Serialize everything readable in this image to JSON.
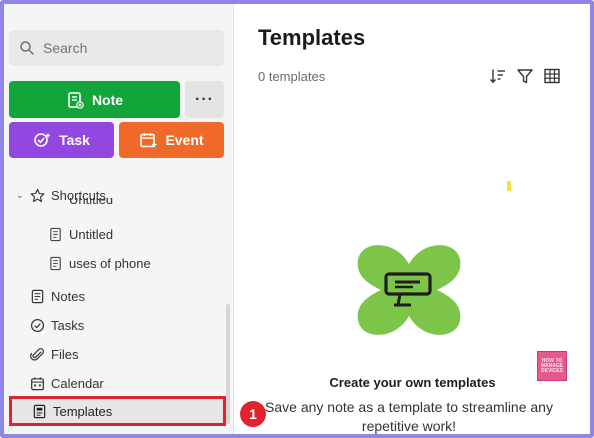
{
  "sidebar": {
    "search": {
      "label": "Search",
      "icon": "search-icon"
    },
    "new_note_label": "Note",
    "more_label": "···",
    "new_task_label": "Task",
    "new_event_label": "Event",
    "shortcuts": {
      "label": "Shortcuts",
      "items": [
        {
          "label": "Untitled",
          "clipped": true
        },
        {
          "label": "Untitled"
        },
        {
          "label": "uses of phone"
        }
      ]
    },
    "nav": [
      {
        "label": "Notes",
        "icon": "notes-icon"
      },
      {
        "label": "Tasks",
        "icon": "tasks-icon"
      },
      {
        "label": "Files",
        "icon": "paperclip-icon"
      },
      {
        "label": "Calendar",
        "icon": "calendar-icon"
      },
      {
        "label": "Templates",
        "icon": "template-icon",
        "selected": true
      }
    ]
  },
  "main": {
    "title": "Templates",
    "count": "0 templates",
    "tools": [
      "sort-icon",
      "filter-icon",
      "view-options-icon"
    ],
    "empty_state": {
      "title": "Create your own templates",
      "description": "Save any note as a template to streamline any repetitive work!"
    }
  },
  "annotation": {
    "step": "1",
    "color": "#e0242f"
  },
  "watermark_text": "HOW TO MANAGE DEVICES",
  "colors": {
    "note_button": "#12a63a",
    "task_button": "#9147e0",
    "event_button": "#ef6a2a",
    "highlight": "#e0242f",
    "illustration": "#7dc548",
    "frame": "#8f86e8"
  }
}
